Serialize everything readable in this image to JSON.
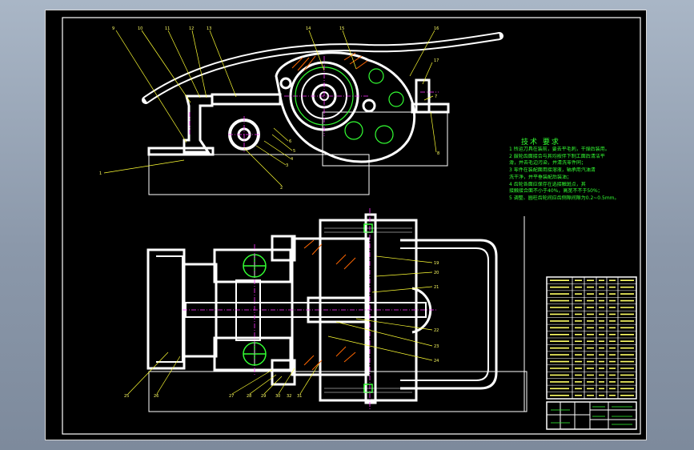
{
  "drawing": {
    "title": "",
    "colors": {
      "background": "#9aa7b8",
      "sheet": "#000000",
      "outline": "#ffffff",
      "centerline": "#ff33ff",
      "leader": "#ffff33",
      "note_text": "#33ff33",
      "table_text": "#ffff66"
    }
  },
  "tech_requirements": {
    "title": "技术 要求",
    "notes": [
      "1 所运刀具在装前，要去平毛刺，干燥后装用。",
      "2 鼓轮齿面接合与其均按伴下制工面后清洁平",
      "滑，并去毛边污染，并清洗零件同；",
      "3 零件在装配面用接溶液，轴承用汽油清",
      "洗干净，并平垂装配后装油；",
      "4 齿轮各面应保存在选接触斑点，其",
      "接触接合面不小于40%，高宽不不于50%；",
      "5 调整、圆柱齿轮间应齿侧隙间隙为0.2~0.5mm。"
    ]
  },
  "callouts": {
    "top_view": [
      "9",
      "10",
      "11",
      "12",
      "13",
      "14",
      "15",
      "16",
      "17",
      "1",
      "2",
      "3",
      "4",
      "5",
      "6",
      "7",
      "8"
    ],
    "bottom_view": [
      "19",
      "20",
      "21",
      "22",
      "23",
      "24",
      "25",
      "26",
      "27",
      "28",
      "29",
      "30",
      "31",
      "32"
    ]
  },
  "parts_list": {
    "title": "",
    "rows": 18
  },
  "title_block": {
    "labels": []
  }
}
